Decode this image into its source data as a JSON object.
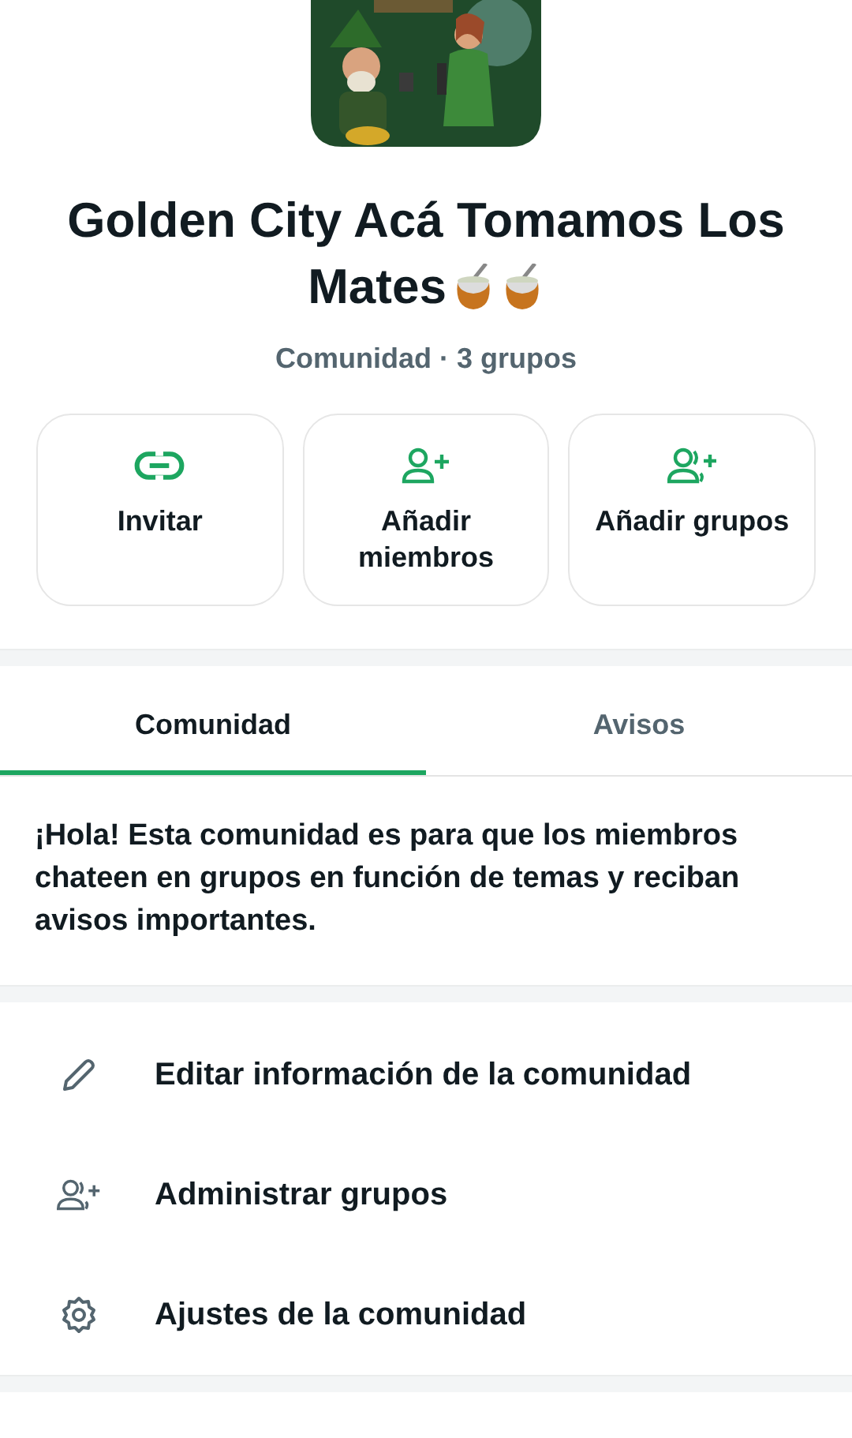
{
  "header": {
    "picture": {
      "kind": "picture"
    },
    "title_lines": [
      "Golden City Acá Tomamos Los",
      "Mates"
    ],
    "title_icons": [
      {
        "kind": "mate"
      },
      {
        "kind": "mate"
      }
    ],
    "subtitle": "Comunidad · 3 grupos"
  },
  "actions": [
    {
      "kind": "link",
      "label": "Invitar"
    },
    {
      "kind": "add-person",
      "label": "Añadir miembros"
    },
    {
      "kind": "add-group",
      "label": "Añadir grupos"
    }
  ],
  "tabs": [
    {
      "label": "Comunidad",
      "selected": true
    },
    {
      "label": "Avisos",
      "selected": false
    }
  ],
  "description": "¡Hola! Esta comunidad es para que los miembros chateen en grupos en función de temas y reciban avisos importantes.",
  "menu": [
    {
      "kind": "edit",
      "label": "Editar información de la comunidad"
    },
    {
      "kind": "groups",
      "label": "Administrar grupos"
    },
    {
      "kind": "settings",
      "label": "Ajustes de la comunidad"
    }
  ]
}
